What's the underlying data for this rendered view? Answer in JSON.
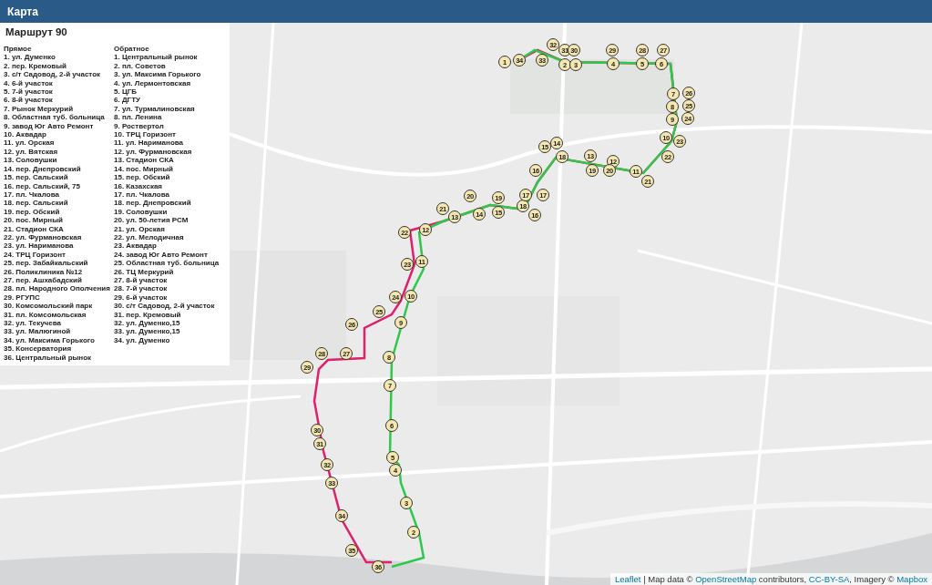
{
  "header": {
    "title": "Карта"
  },
  "legend": {
    "title": "Маршрут 90",
    "columns": [
      {
        "heading": "Прямое",
        "items": [
          "1. ул. Думенко",
          "2. пер. Кремовый",
          "3. с/т Садовод, 2-й участок",
          "4. 6-й участок",
          "5. 7-й участок",
          "6. 8-й участок",
          "7. Рынок Меркурий",
          "8. Областная туб. больница",
          "9. завод Юг Авто Ремонт",
          "10. Аквадар",
          "11. ул. Орская",
          "12. ул. Вятская",
          "13. Соловушки",
          "14. пер. Днепровский",
          "15. пер. Сальский",
          "16. пер. Сальский, 75",
          "17. пл. Чкалова",
          "18. пер. Сальский",
          "19. пер. Обский",
          "20. пос. Мирный",
          "21. Стадион СКА",
          "22. ул. Фурмановская",
          "23. ул. Нариманова",
          "24. ТРЦ Горизонт",
          "25. пер. Забайкальский",
          "26. Поликлиника №12",
          "27. пер. Ашхабадский",
          "28. пл. Народного Ополчения",
          "29. РГУПС",
          "30. Комсомольский парк",
          "31. пл. Комсомольская",
          "32. ул. Текучева",
          "33. ул. Малюгиной",
          "34. ул. Максима Горького",
          "35. Консерватория",
          "36. Центральный рынок"
        ]
      },
      {
        "heading": "Обратное",
        "items": [
          "1. Центральный рынок",
          "2. пл. Советов",
          "3. ул. Максима Горького",
          "4. ул. Лермонтовская",
          "5. ЦГБ",
          "6. ДГТУ",
          "7. ул. Турмалиновская",
          "8. пл. Ленина",
          "9. Роствертол",
          "10. ТРЦ Горизонт",
          "11. ул. Нариманова",
          "12. ул. Фурмановская",
          "13. Стадион СКА",
          "14. пос. Мирный",
          "15. пер. Обский",
          "16. Казахская",
          "17. пл. Чкалова",
          "18. пер. Днепровский",
          "19. Соловушки",
          "20. ул. 50-летия РСМ",
          "21. ул. Орская",
          "22. ул. Мелодичная",
          "23. Аквадар",
          "24. завод Юг Авто Ремонт",
          "25. Областная туб. больница",
          "26. ТЦ Меркурий",
          "27. 8-й участок",
          "28. 7-й участок",
          "29. 6-й участок",
          "30. с/т Садовод, 2-й участок",
          "31. пер. Кремовый",
          "32. ул. Думенко,15",
          "33. ул. Думенко,15",
          "34. ул. Думенко"
        ]
      }
    ]
  },
  "map": {
    "forward_stops": [
      "1",
      "2",
      "3",
      "4",
      "5",
      "6",
      "7",
      "8",
      "9",
      "10",
      "11",
      "12",
      "13",
      "14",
      "15",
      "16",
      "17",
      "18",
      "19",
      "20",
      "21",
      "22",
      "23",
      "24",
      "25",
      "26",
      "27",
      "28",
      "29",
      "30",
      "31",
      "32",
      "33",
      "34",
      "35",
      "36"
    ],
    "backward_stops": [
      "32",
      "31",
      "30",
      "29",
      "28",
      "27",
      "34",
      "33",
      "26",
      "25",
      "24",
      "23",
      "18",
      "22",
      "19",
      "20",
      "21",
      "17",
      "13",
      "14",
      "15",
      "16",
      "12",
      "11",
      "10",
      "9",
      "8",
      "7",
      "6",
      "5",
      "4",
      "3",
      "2"
    ],
    "attribution": [
      {
        "kind": "link",
        "text": "Leaflet"
      },
      {
        "kind": "text",
        "text": " | Map data © "
      },
      {
        "kind": "link",
        "text": "OpenStreetMap"
      },
      {
        "kind": "text",
        "text": " contributors, "
      },
      {
        "kind": "link",
        "text": "CC-BY-SA"
      },
      {
        "kind": "text",
        "text": ", Imagery © "
      },
      {
        "kind": "link",
        "text": "Mapbox"
      }
    ]
  }
}
